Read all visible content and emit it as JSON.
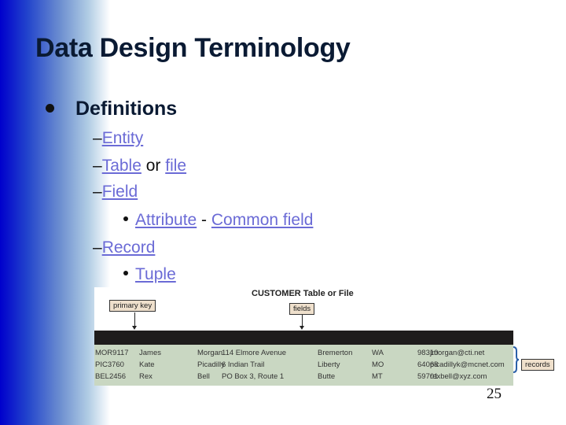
{
  "slide": {
    "title": "Data Design Terminology",
    "bullet": "Definitions",
    "items": [
      {
        "dash": "–",
        "parts": [
          {
            "text": "Entity",
            "link": true
          }
        ]
      },
      {
        "dash": "–",
        "parts": [
          {
            "text": "Table",
            "link": true
          },
          {
            "text": " or ",
            "link": false
          },
          {
            "text": "file",
            "link": true
          }
        ]
      },
      {
        "dash": "–",
        "parts": [
          {
            "text": "Field",
            "link": true
          }
        ]
      },
      {
        "dash": "–",
        "parts": [
          {
            "text": "Record",
            "link": true
          }
        ]
      }
    ],
    "field_sub": {
      "term": "Attribute",
      "separator": " - ",
      "definition": "Common field"
    },
    "record_sub": {
      "term": "Tuple"
    },
    "page_number": "25",
    "link_color": "#6b6bd6"
  },
  "figure": {
    "title": "CUSTOMER Table or File",
    "primary_key_label": "primary key",
    "fields_label": "fields",
    "records_label": "records",
    "rows": [
      [
        "MOR9117",
        "James",
        "Morgan",
        "114 Elmore Avenue",
        "Bremerton",
        "WA",
        "98310",
        "jmorgan@cti.net"
      ],
      [
        "PIC3760",
        "Kate",
        "Picadilly",
        "6 Indian Trail",
        "Liberty",
        "MO",
        "64068",
        "picadillyk@mcnet.com"
      ],
      [
        "BEL2456",
        "Rex",
        "Bell",
        "PO Box 3, Route 1",
        "Butte",
        "MT",
        "59701",
        "rexbell@xyz.com"
      ]
    ]
  }
}
